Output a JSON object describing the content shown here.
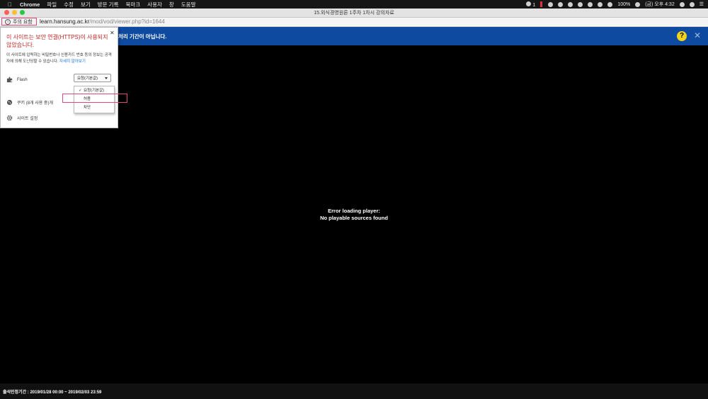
{
  "menubar": {
    "app": "Chrome",
    "items": [
      "파일",
      "수정",
      "보기",
      "방문 기록",
      "북마크",
      "사용자",
      "창",
      "도움말"
    ],
    "status": {
      "notifications": "1",
      "battery": "100%",
      "datetime": "(금) 오후 4:32"
    }
  },
  "window": {
    "title": "15.외식경영원론 1주차 1차시 강의자료"
  },
  "urlbar": {
    "security_label": "주의 요함",
    "host": "learn.hansung.ac.kr",
    "path": "/mod/vod/viewer.php?id=1644"
  },
  "notice": {
    "text": "처리 기간이 아닙니다.",
    "help": "?"
  },
  "popup": {
    "warning_title": "이 사이트는 보안 연결(HTTPS)이 사용되지 않았습니다.",
    "description": "이 사이트에 입력하는 비밀번호나 신용카드 번호 등의 정보는 공격자에 의해 도난당할 수 있습니다.",
    "learn_more": "자세히 알아보기",
    "flash_label": "Flash",
    "flash_value": "요청(기본값)",
    "dropdown_options": [
      "요청(기본값)",
      "허용",
      "차단"
    ],
    "cookies_label": "쿠키 (8개 사용 중)개",
    "site_settings_label": "사이트 설정"
  },
  "player": {
    "error_line1": "Error loading player:",
    "error_line2": "No playable sources found"
  },
  "footer": {
    "text": "출석인정기간 : 2019/01/28 00:00 ~ 2019/02/03 23:59"
  }
}
